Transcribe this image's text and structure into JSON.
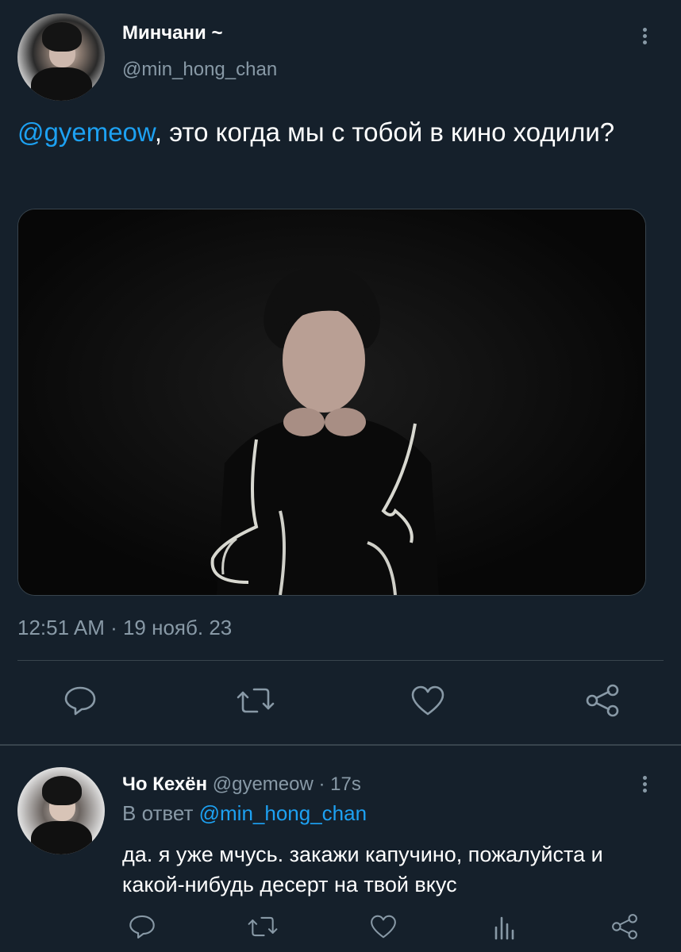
{
  "tweet": {
    "display_name": "Минчани ~",
    "handle": "@min_hong_chan",
    "mention": "@gyemeow",
    "text": ", это когда мы с тобой в кино ходили?",
    "timestamp": "12:51 AM · 19 нояб. 23",
    "actions": [
      "reply-icon",
      "retweet-icon",
      "like-icon",
      "share-icon"
    ]
  },
  "reply": {
    "display_name": "Чо Кехён",
    "meta": "@gyemeow · 17s",
    "replying_prefix": "В ответ",
    "replying_to": "@min_hong_chan",
    "text": "да. я уже мчусь. закажи капучино, пожалуйста и какой-нибудь десерт на твой вкус",
    "actions": [
      "reply-icon",
      "retweet-icon",
      "like-icon",
      "analytics-icon",
      "share-icon"
    ]
  },
  "colors": {
    "background": "#15202b",
    "secondary_text": "#8899a6",
    "accent": "#1da1f2",
    "divider": "#38444d"
  }
}
